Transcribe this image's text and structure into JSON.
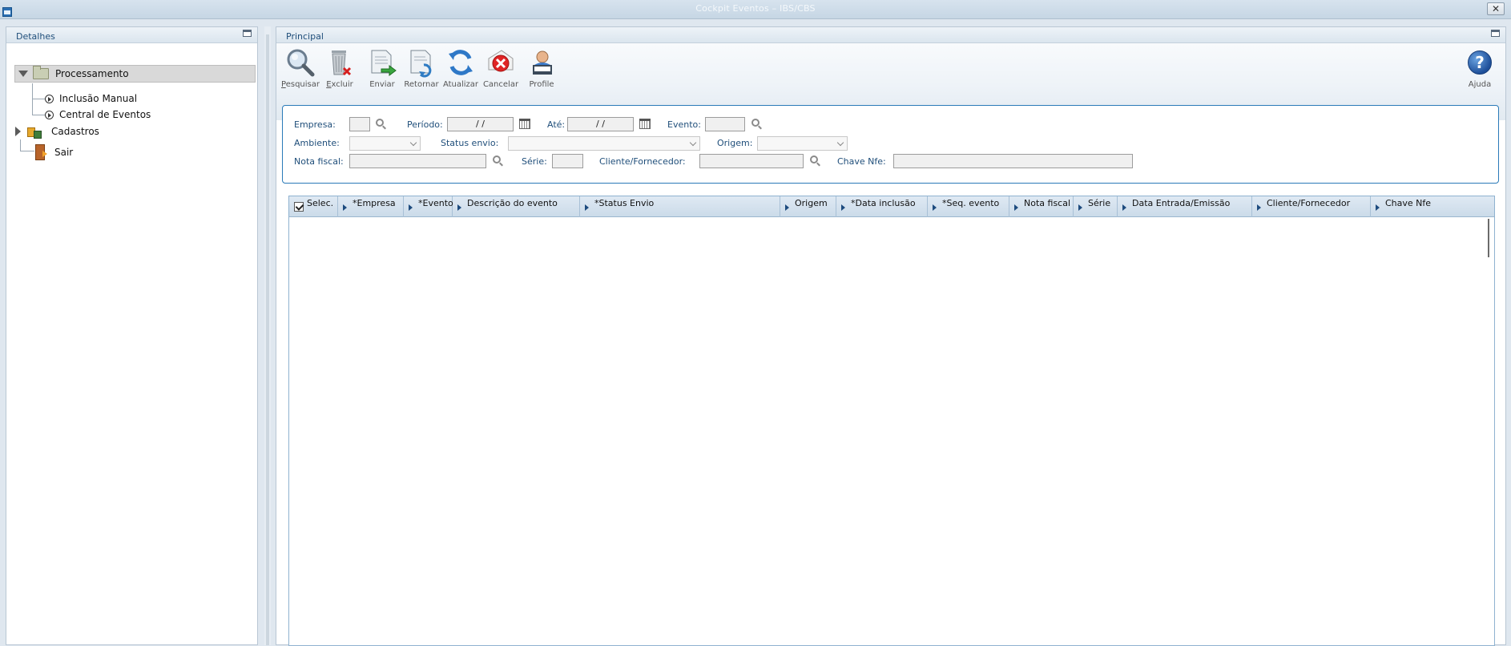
{
  "window": {
    "title": "Cockpit Eventos – IBS/CBS",
    "close_label": "✕"
  },
  "left_panel": {
    "title": "Detalhes",
    "tree": {
      "processamento": "Processamento",
      "inclusao_manual": "Inclusão Manual",
      "central_eventos": "Central de Eventos",
      "cadastros": "Cadastros",
      "sair": "Sair"
    }
  },
  "right_panel": {
    "title": "Principal",
    "toolbar": {
      "pesquisar_first": "P",
      "pesquisar_rest": "esquisar",
      "excluir_first": "E",
      "excluir_rest": "xcluir",
      "enviar": "Enviar",
      "retornar": "Retornar",
      "atualizar": "Atualizar",
      "cancelar": "Cancelar",
      "profile": "Profile",
      "ajuda": "Ajuda"
    },
    "filters": {
      "empresa_label": "Empresa:",
      "empresa_value": "",
      "periodo_label": "Período:",
      "periodo_value": "/ /",
      "ate_label": "Até:",
      "ate_value": "/ /",
      "evento_label": "Evento:",
      "evento_value": "",
      "ambiente_label": "Ambiente:",
      "status_envio_label": "Status envio:",
      "origem_label": "Origem:",
      "nota_fiscal_label": "Nota fiscal:",
      "serie_label": "Série:",
      "cliente_fornecedor_label": "Cliente/Fornecedor:",
      "chave_nfe_label": "Chave Nfe:"
    },
    "grid": {
      "columns": [
        "Selec.",
        "*Empresa",
        "*Evento",
        "Descrição do evento",
        "*Status Envio",
        "Origem",
        "*Data inclusão",
        "*Seq. evento",
        "Nota fiscal",
        "Série",
        "Data Entrada/Emissão",
        "Cliente/Fornecedor",
        "Chave Nfe"
      ],
      "select_all_checked": true
    }
  }
}
